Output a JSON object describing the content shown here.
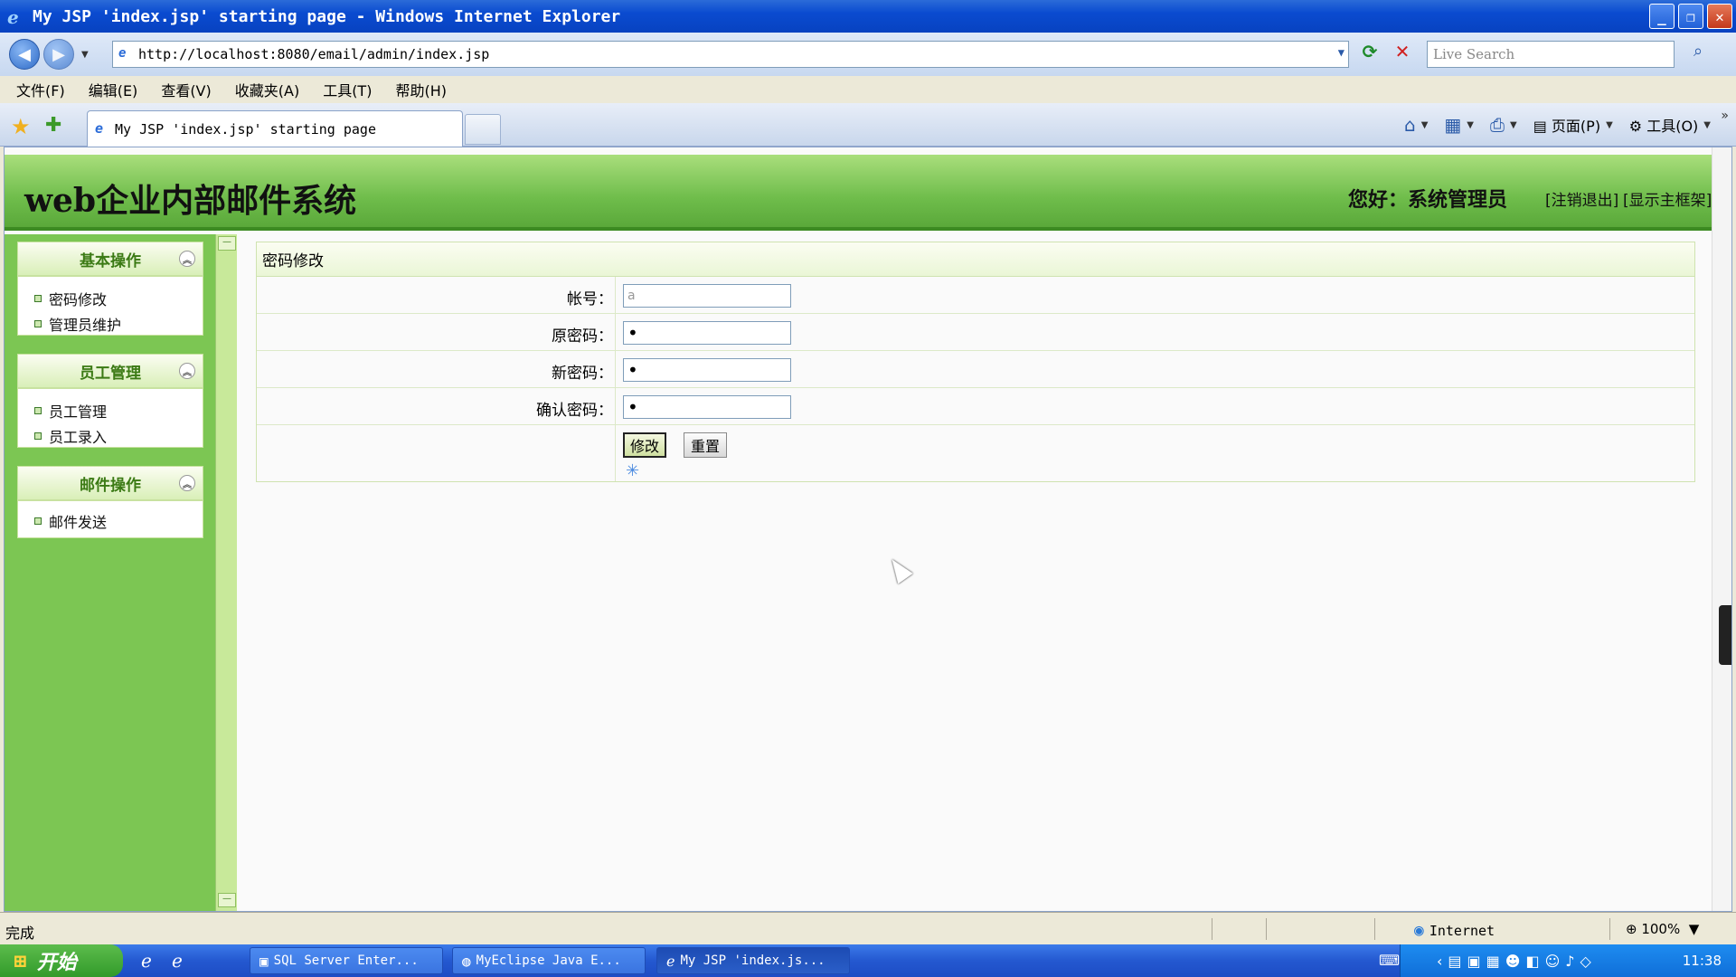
{
  "window": {
    "title": "My JSP 'index.jsp' starting page - Windows Internet Explorer",
    "minimize": "_",
    "restore": "❐",
    "close": "✕"
  },
  "address": {
    "url": "http://localhost:8080/email/admin/index.jsp",
    "search_placeholder": "Live Search"
  },
  "menu": [
    "文件(F)",
    "编辑(E)",
    "查看(V)",
    "收藏夹(A)",
    "工具(T)",
    "帮助(H)"
  ],
  "tab": {
    "title": "My JSP 'index.jsp' starting page"
  },
  "commands": {
    "page_label": "页面(P)",
    "tools_label": "工具(O)"
  },
  "header": {
    "site_title": "web企业内部邮件系统",
    "greeting": "您好：系统管理员",
    "logout": "[注销退出]",
    "show_frame": "[显示主框架]"
  },
  "sidebar": {
    "groups": [
      {
        "title": "基本操作",
        "items": [
          "密码修改",
          "管理员维护"
        ]
      },
      {
        "title": "员工管理",
        "items": [
          "员工管理",
          "员工录入"
        ]
      },
      {
        "title": "邮件操作",
        "items": [
          "邮件发送"
        ]
      }
    ]
  },
  "form": {
    "title": "密码修改",
    "fields": [
      {
        "label": "帐号：",
        "value": "a"
      },
      {
        "label": "原密码：",
        "value": "•"
      },
      {
        "label": "新密码：",
        "value": "•"
      },
      {
        "label": "确认密码：",
        "value": "•"
      }
    ],
    "submit": "修改",
    "reset": "重置"
  },
  "status": {
    "text": "完成",
    "zone": "Internet",
    "zoom": "100%"
  },
  "taskbar": {
    "start": "开始",
    "tasks": [
      "SQL Server Enter...",
      "MyEclipse Java E...",
      "My JSP 'index.js..."
    ],
    "clock": "11:38"
  }
}
